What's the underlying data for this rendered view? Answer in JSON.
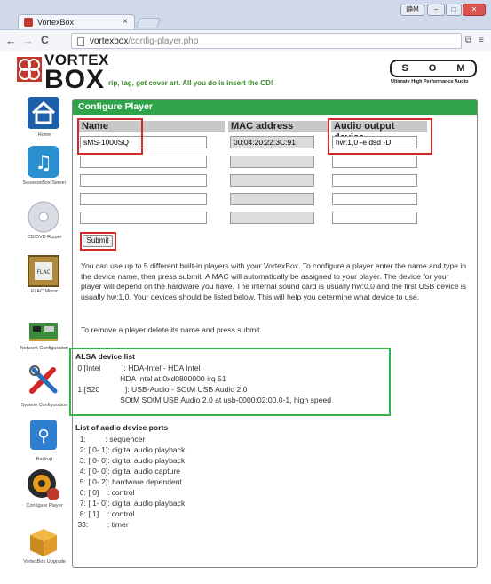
{
  "browser": {
    "tab_title": "VortexBox",
    "tab_close": "×",
    "back": "←",
    "forward": "→",
    "reload": "C",
    "url_host": "vortexbox",
    "url_path": "/config-player.php",
    "window_user": "静M",
    "win_min": "–",
    "win_max": "□",
    "win_close": "✕"
  },
  "header": {
    "logo_line1": "VORTEX",
    "logo_line2": "BOX",
    "tagline": "rip, tag, get cover art. All you do is insert the CD!",
    "som_letters": [
      "S",
      "O",
      "M"
    ],
    "som_subtitle": "Ultimate High Performance Audio"
  },
  "sidebar": {
    "items": [
      {
        "label": "Home",
        "icon": "home-icon"
      },
      {
        "label": "SqueezeBox Server",
        "icon": "squeezebox-icon"
      },
      {
        "label": "CD/DVD Ripper",
        "icon": "cd-icon"
      },
      {
        "label": "FLAC Mirror",
        "icon": "flac-icon"
      },
      {
        "label": "Network Configuration",
        "icon": "network-card-icon"
      },
      {
        "label": "System Configuration",
        "icon": "tools-icon"
      },
      {
        "label": "Backup",
        "icon": "usb-drive-icon"
      },
      {
        "label": "Configure Player",
        "icon": "speaker-icon"
      },
      {
        "label": "VortexBox Upgrade",
        "icon": "package-icon"
      }
    ]
  },
  "panel": {
    "title": "Configure Player",
    "col_name": "Name",
    "col_mac": "MAC address",
    "col_audio": "Audio output device",
    "rows": [
      {
        "name": "sMS-1000SQ",
        "mac": "00:04:20:22:3C:91",
        "audio": "hw:1,0 -e dsd -D"
      },
      {
        "name": "",
        "mac": "",
        "audio": ""
      },
      {
        "name": "",
        "mac": "",
        "audio": ""
      },
      {
        "name": "",
        "mac": "",
        "audio": ""
      },
      {
        "name": "",
        "mac": "",
        "audio": ""
      }
    ],
    "submit_label": "Submit",
    "help_text": "You can use up to 5 different built-in players with your VortexBox. To configure a player enter the name and type in the device name, then press submit. A MAC will automatically be assigned to your player. The device for your player will depend on the hardware you have. The internal sound card is usually hw:0,0 and the first USB device is usually hw:1,0. Your devices should be listed below. This will help you determine what device to use.",
    "remove_text": "To remove a player delete its name and press submit.",
    "alsa_title": "ALSA device list",
    "alsa_lines": [
      " 0 [Intel          ]: HDA-Intel - HDA Intel",
      "                     HDA Intel at 0xd0800000 irq 51",
      " 1 [S20            ]: USB-Audio - SOtM USB Audio 2.0",
      "                     SOtM SOtM USB Audio 2.0 at usb-0000:02:00.0-1, high speed"
    ],
    "ports_title": "List of audio device ports",
    "ports_lines": [
      "  1:         : sequencer",
      "  2: [ 0- 1]: digital audio playback",
      "  3: [ 0- 0]: digital audio playback",
      "  4: [ 0- 0]: digital audio capture",
      "  5: [ 0- 2]: hardware dependent",
      "  6: [ 0]    : control",
      "  7: [ 1- 0]: digital audio playback",
      "  8: [ 1]    : control",
      " 33:         : timer"
    ]
  },
  "colors": {
    "accent_green": "#2fa34a",
    "highlight_red": "#d42828",
    "highlight_green": "#38b24a"
  }
}
